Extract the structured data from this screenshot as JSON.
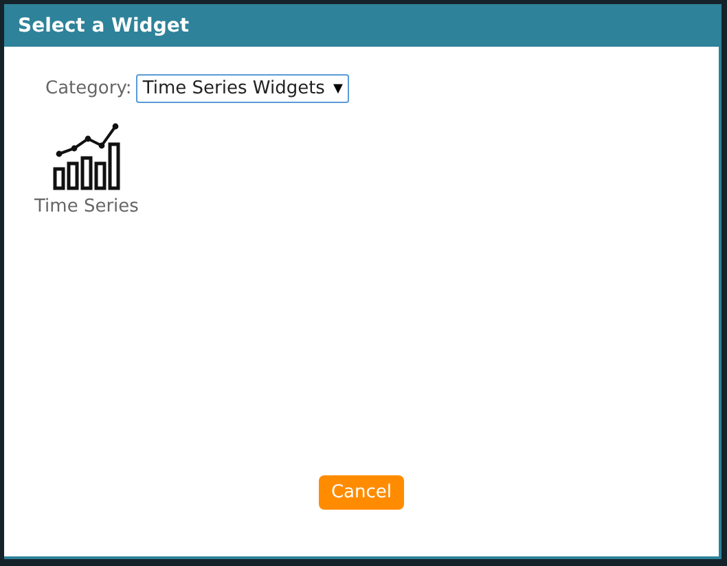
{
  "dialog": {
    "title": "Select a Widget"
  },
  "category": {
    "label": "Category:",
    "value": "Time Series Widgets",
    "caret": "▼"
  },
  "widgets": [
    {
      "label": "Time Series",
      "selected": false
    }
  ],
  "buttons": [
    {
      "label": "Cancel"
    }
  ]
}
